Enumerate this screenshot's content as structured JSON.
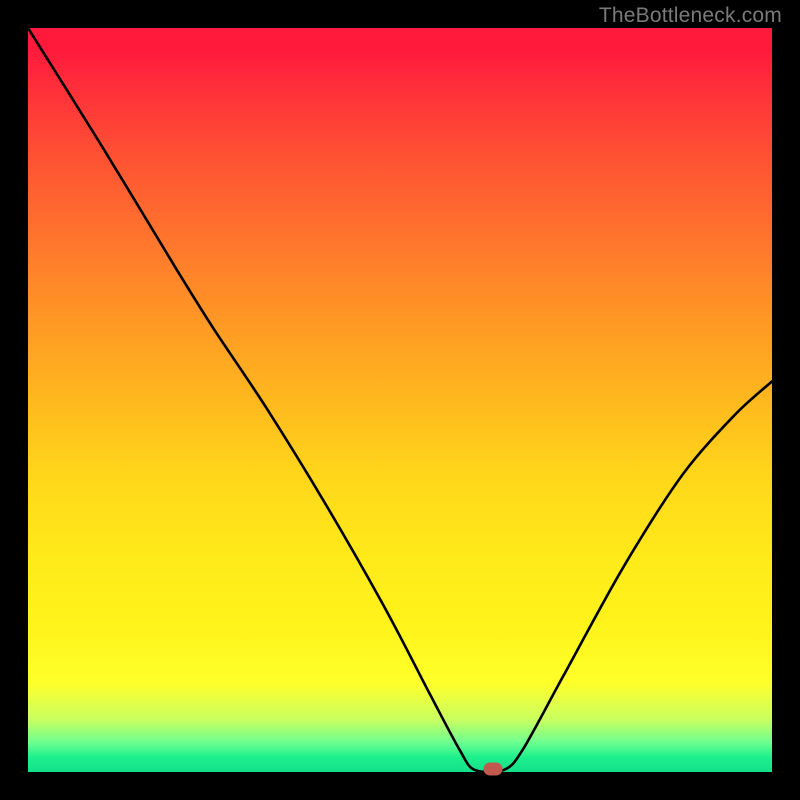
{
  "watermark": "TheBottleneck.com",
  "chart_data": {
    "type": "line",
    "title": "",
    "xlabel": "",
    "ylabel": "",
    "xlim": [
      0,
      100
    ],
    "ylim": [
      0,
      100
    ],
    "marker": {
      "x": 62.5,
      "y": 0
    },
    "series": [
      {
        "name": "bottleneck-curve",
        "points": [
          {
            "x": 0.0,
            "y": 100.0
          },
          {
            "x": 10.0,
            "y": 84.0
          },
          {
            "x": 20.0,
            "y": 67.5
          },
          {
            "x": 25.0,
            "y": 59.5
          },
          {
            "x": 32.0,
            "y": 49.0
          },
          {
            "x": 40.0,
            "y": 36.0
          },
          {
            "x": 48.0,
            "y": 22.0
          },
          {
            "x": 54.0,
            "y": 10.5
          },
          {
            "x": 58.0,
            "y": 3.0
          },
          {
            "x": 60.0,
            "y": 0.3
          },
          {
            "x": 64.0,
            "y": 0.3
          },
          {
            "x": 66.5,
            "y": 3.0
          },
          {
            "x": 72.0,
            "y": 13.0
          },
          {
            "x": 80.0,
            "y": 27.5
          },
          {
            "x": 88.0,
            "y": 40.0
          },
          {
            "x": 95.0,
            "y": 48.0
          },
          {
            "x": 100.0,
            "y": 52.5
          }
        ]
      }
    ]
  },
  "colors": {
    "curve_stroke": "#000000",
    "marker_fill": "#c1594f",
    "watermark": "#7a7a7a"
  }
}
